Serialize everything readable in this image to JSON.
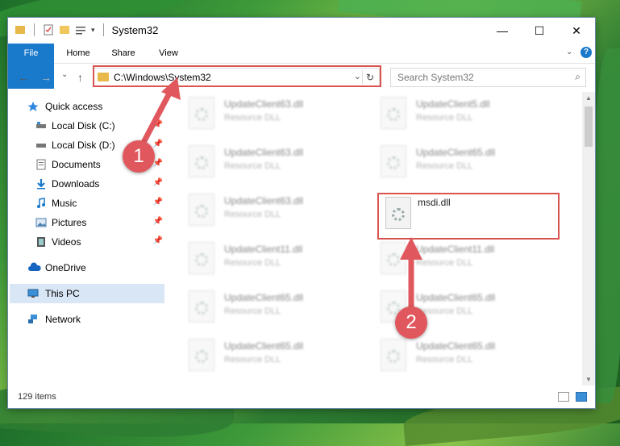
{
  "window": {
    "title": "System32",
    "controls": {
      "minimize": "—",
      "maximize": "☐",
      "close": "✕"
    }
  },
  "ribbon": {
    "tabs": [
      "File",
      "Home",
      "Share",
      "View"
    ],
    "help": "?"
  },
  "navbar": {
    "back": "←",
    "forward": "→",
    "recent": "⌄",
    "up": "↑",
    "address": "C:\\Windows\\System32",
    "address_dropdown": "⌄",
    "refresh": "↻",
    "search_placeholder": "Search System32",
    "search_icon": "⌕"
  },
  "sidebar": {
    "items": [
      {
        "label": "Quick access",
        "icon": "star-icon"
      },
      {
        "label": "Local Disk (C:)",
        "icon": "drive-icon",
        "pin": "📌"
      },
      {
        "label": "Local Disk (D:)",
        "icon": "drive-icon",
        "pin": "📌"
      },
      {
        "label": "Documents",
        "icon": "documents-icon",
        "pin": "📌"
      },
      {
        "label": "Downloads",
        "icon": "download-icon",
        "pin": "📌"
      },
      {
        "label": "Music",
        "icon": "music-icon",
        "pin": "📌"
      },
      {
        "label": "Pictures",
        "icon": "pictures-icon",
        "pin": "📌"
      },
      {
        "label": "Videos",
        "icon": "videos-icon",
        "pin": "📌"
      },
      {
        "label": "OneDrive",
        "icon": "cloud-icon"
      },
      {
        "label": "This PC",
        "icon": "computer-icon"
      },
      {
        "label": "Network",
        "icon": "network-icon"
      }
    ]
  },
  "files": [
    {
      "name": "UpdateClient63.dll",
      "type": "Resource DLL"
    },
    {
      "name": "UpdateClient5.dll",
      "type": "Resource DLL"
    },
    {
      "name": "UpdateClient63.dll",
      "type": "Resource DLL"
    },
    {
      "name": "UpdateClient65.dll",
      "type": "Resource DLL"
    },
    {
      "name": "UpdateClient63.dll",
      "type": "Resource DLL"
    },
    {
      "name": "msdi.dll",
      "type": ""
    },
    {
      "name": "UpdateClient11.dll",
      "type": "Resource DLL"
    },
    {
      "name": "UpdateClient11.dll",
      "type": "Resource DLL"
    },
    {
      "name": "UpdateClient65.dll",
      "type": "Resource DLL"
    },
    {
      "name": "UpdateClient65.dll",
      "type": "Resource DLL"
    },
    {
      "name": "UpdateClient65.dll",
      "type": "Resource DLL"
    },
    {
      "name": "UpdateClient65.dll",
      "type": "Resource DLL"
    }
  ],
  "status": {
    "items_count": "129 items"
  },
  "annotations": {
    "step1": "1",
    "step2": "2",
    "color": "#e0585e"
  }
}
